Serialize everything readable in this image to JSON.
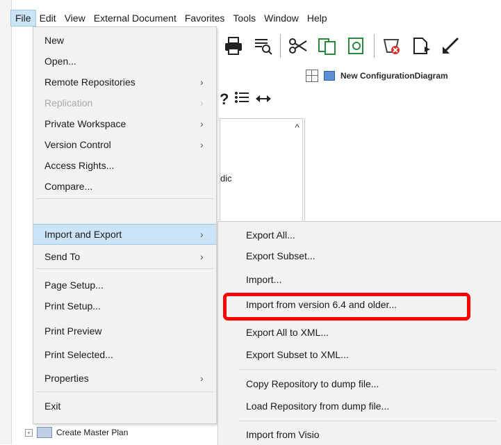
{
  "menubar": {
    "items": [
      "File",
      "Edit",
      "View",
      "External Document",
      "Favorites",
      "Tools",
      "Window",
      "Help"
    ]
  },
  "toolbar": {
    "icons": [
      "print-icon",
      "print-preview-icon",
      "cut-icon",
      "copy-icon",
      "paste-icon",
      "delete-icon",
      "new-document-icon",
      "resize-icon"
    ]
  },
  "tab": {
    "label": "New ConfigurationDiagram"
  },
  "panel": {
    "truncated_text": "dic"
  },
  "file_menu": {
    "items": [
      {
        "label": "New",
        "arrow": ""
      },
      {
        "label": "Open...",
        "arrow": ""
      },
      {
        "label": "Remote Repositories",
        "arrow": "›"
      },
      {
        "label": "Replication",
        "arrow": "›"
      },
      {
        "label": "Private Workspace",
        "arrow": "›"
      },
      {
        "label": "Version Control",
        "arrow": "›"
      },
      {
        "label": "Access Rights...",
        "arrow": ""
      },
      {
        "label": "Compare...",
        "arrow": ""
      },
      {
        "label": "Import and Export",
        "arrow": "›"
      },
      {
        "label": "Send To",
        "arrow": "›"
      },
      {
        "label": "Page Setup...",
        "arrow": ""
      },
      {
        "label": "Print Setup...",
        "arrow": ""
      },
      {
        "label": "Print Preview",
        "arrow": ""
      },
      {
        "label": "Print Selected...",
        "arrow": ""
      },
      {
        "label": "Properties",
        "arrow": "›"
      },
      {
        "label": "Exit",
        "arrow": ""
      }
    ]
  },
  "submenu": {
    "items": [
      {
        "label": "Export All..."
      },
      {
        "label": "Export Subset..."
      },
      {
        "label": "Import..."
      },
      {
        "label": "Import from version 6.4 and older..."
      },
      {
        "label": "Export All to XML..."
      },
      {
        "label": "Export Subset to XML..."
      },
      {
        "label": "Copy Repository to dump file..."
      },
      {
        "label": "Load Repository from dump file..."
      },
      {
        "label": "Import from Visio"
      }
    ]
  },
  "tree": {
    "row_label": "Create Master Plan"
  },
  "colors": {
    "highlight": "#cce4f7",
    "annotation": "#ff0000"
  }
}
